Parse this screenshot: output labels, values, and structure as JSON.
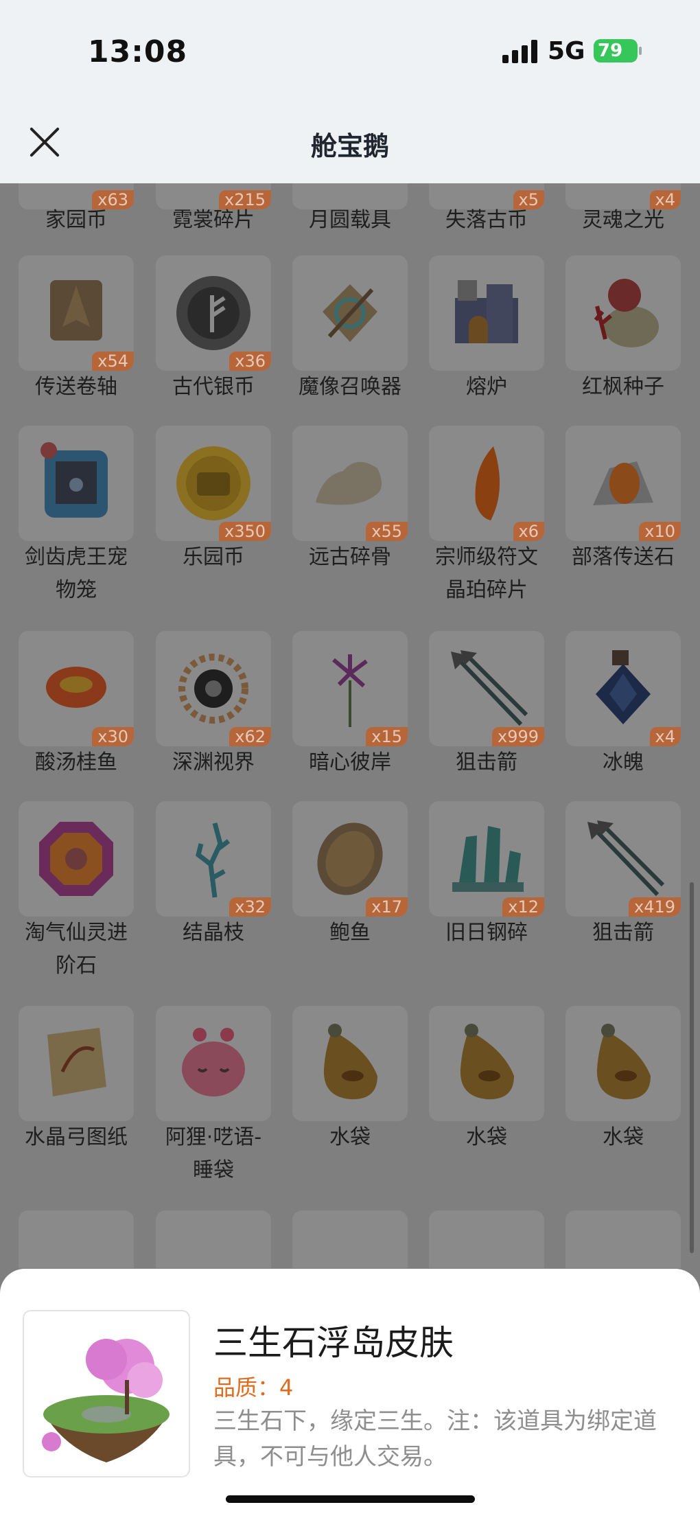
{
  "status": {
    "time": "13:08",
    "network": "5G",
    "battery": "79"
  },
  "header": {
    "title": "舱宝鹅"
  },
  "grid": {
    "row1": [
      {
        "name": "家园币",
        "qty": "x63"
      },
      {
        "name": "霓裳碎片",
        "qty": "x215"
      },
      {
        "name": "月圆载具",
        "qty": ""
      },
      {
        "name": "失落古币",
        "qty": "x5"
      },
      {
        "name": "灵魂之光",
        "qty": "x4"
      }
    ],
    "row2": [
      {
        "name": "传送卷轴",
        "qty": "x54"
      },
      {
        "name": "古代银币",
        "qty": "x36"
      },
      {
        "name": "魔像召唤器",
        "qty": ""
      },
      {
        "name": "熔炉",
        "qty": ""
      },
      {
        "name": "红枫种子",
        "qty": ""
      }
    ],
    "row3": [
      {
        "name_line1": "剑齿虎王宠",
        "name_line2": "物笼",
        "qty": ""
      },
      {
        "name_line1": "乐园币",
        "name_line2": "",
        "qty": "x350"
      },
      {
        "name_line1": "远古碎骨",
        "name_line2": "",
        "qty": "x55"
      },
      {
        "name_line1": "宗师级符文",
        "name_line2": "晶珀碎片",
        "qty": "x6"
      },
      {
        "name_line1": "部落传送石",
        "name_line2": "",
        "qty": "x10"
      }
    ],
    "row4": [
      {
        "name": "酸汤桂鱼",
        "qty": "x30"
      },
      {
        "name": "深渊视界",
        "qty": "x62"
      },
      {
        "name": "暗心彼岸",
        "qty": "x15"
      },
      {
        "name": "狙击箭",
        "qty": "x999"
      },
      {
        "name": "冰魄",
        "qty": "x4"
      }
    ],
    "row5": [
      {
        "name_line1": "淘气仙灵进",
        "name_line2": "阶石",
        "qty": ""
      },
      {
        "name_line1": "结晶枝",
        "name_line2": "",
        "qty": "x32"
      },
      {
        "name_line1": "鲍鱼",
        "name_line2": "",
        "qty": "x17"
      },
      {
        "name_line1": "旧日钢碎",
        "name_line2": "",
        "qty": "x12"
      },
      {
        "name_line1": "狙击箭",
        "name_line2": "",
        "qty": "x419"
      }
    ],
    "row6": [
      {
        "name_line1": "水晶弓图纸",
        "name_line2": ""
      },
      {
        "name_line1": "阿狸·呓语-",
        "name_line2": "睡袋"
      },
      {
        "name_line1": "水袋",
        "name_line2": ""
      },
      {
        "name_line1": "水袋",
        "name_line2": ""
      },
      {
        "name_line1": "水袋",
        "name_line2": ""
      }
    ]
  },
  "detail": {
    "title": "三生石浮岛皮肤",
    "quality": "品质：4",
    "description": "三生石下，缘定三生。注：该道具为绑定道具，不可与他人交易。"
  },
  "icons": [
    "scroll-icon",
    "silver-coin-icon",
    "golem-summoner-icon",
    "furnace-icon",
    "seed-bag-icon",
    "pet-cage-icon",
    "gold-coin-icon",
    "bone-icon",
    "amber-shard-icon",
    "teleport-stone-icon",
    "fish-dish-icon",
    "abyss-eye-icon",
    "flower-icon",
    "arrow-icon",
    "ice-potion-icon",
    "rune-stone-icon",
    "crystal-branch-icon",
    "abalone-icon",
    "steel-shard-icon",
    "blueprint-icon",
    "sleeping-bag-icon",
    "water-bag-icon"
  ]
}
